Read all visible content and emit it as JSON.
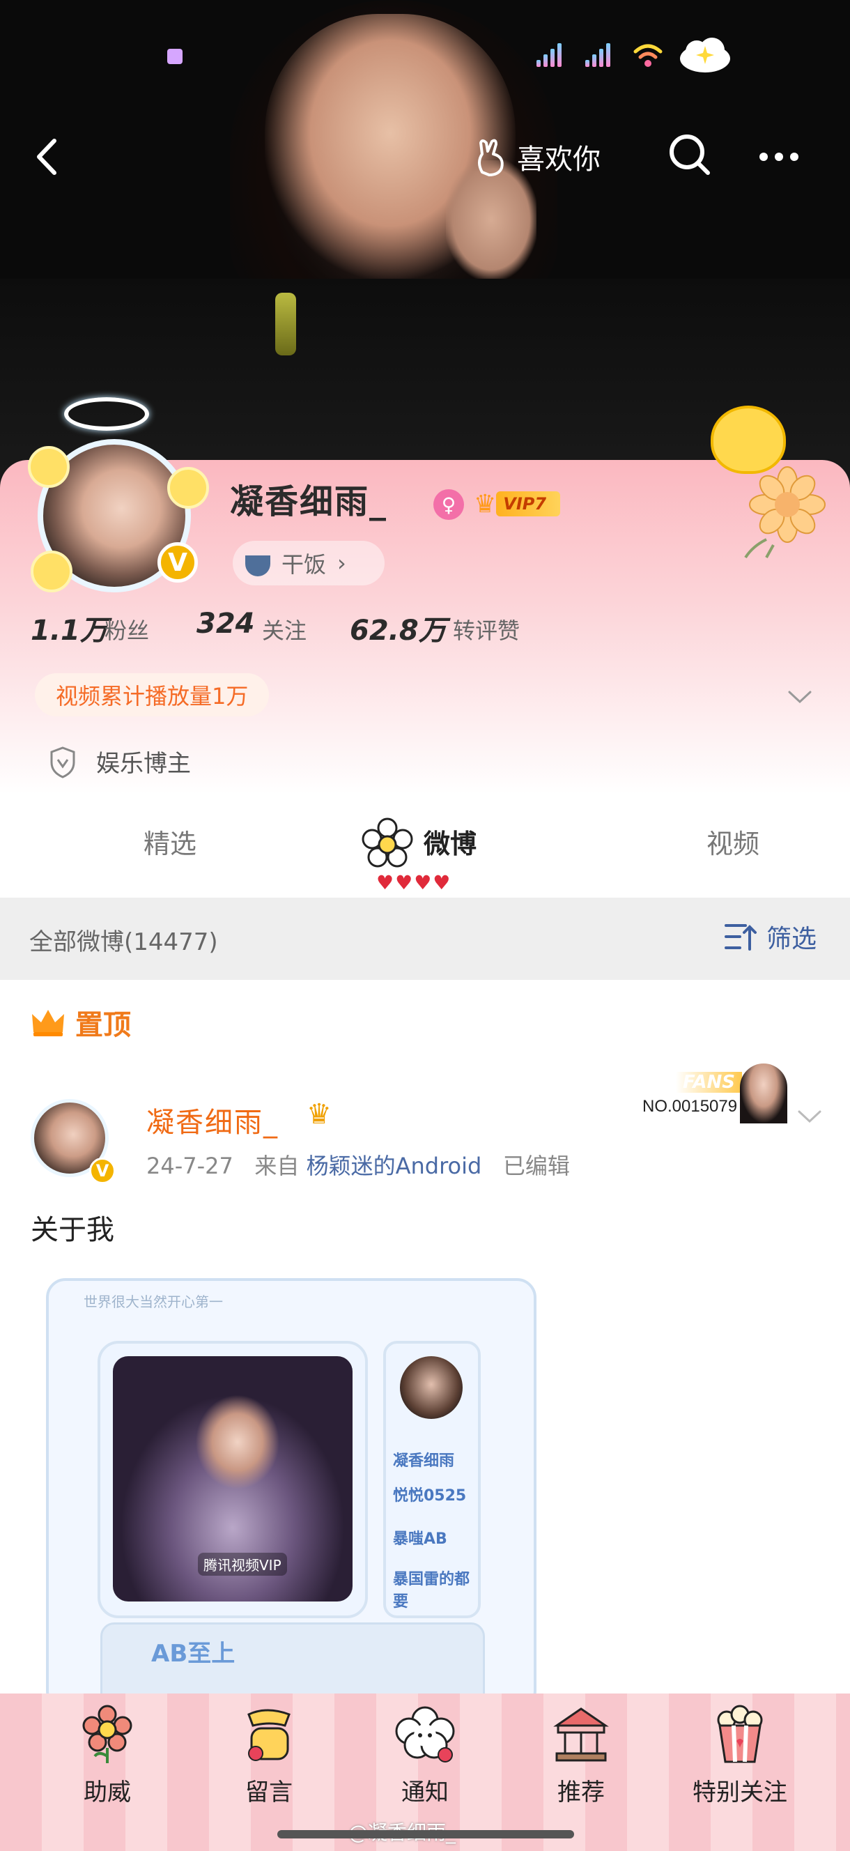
{
  "header": {
    "like_you_label": "喜欢你"
  },
  "profile": {
    "username": "凝香细雨_",
    "vip_label": "VIP7",
    "status_label": "干饭",
    "verified_mark": "V",
    "gender_symbol": "♀",
    "stats": [
      {
        "value": "1.1万",
        "label": "粉丝"
      },
      {
        "value": "324",
        "label": "关注"
      },
      {
        "value": "62.8万",
        "label": "转评赞"
      }
    ],
    "video_plays": "视频累计播放量1万",
    "category": "娱乐博主"
  },
  "tabs": [
    {
      "label": "精选"
    },
    {
      "label": "微博"
    },
    {
      "label": "视频"
    }
  ],
  "tab_hearts": "♥♥♥♥",
  "filter": {
    "all_posts": "全部微博(14477)",
    "filter_label": "筛选"
  },
  "pinned": {
    "label": "置顶",
    "author": "凝香细雨_",
    "date": "24-7-27",
    "from_prefix": "来自",
    "source": "杨颖迷的Android",
    "edited": "已编辑",
    "fans_label": "FANS",
    "fans_number": "NO.0015079",
    "text": "关于我",
    "image": {
      "top_text": "世界很大当然开心第一",
      "video_tag": "腾讯视频VIP",
      "side_lines": [
        "凝香细雨",
        "悦悦0525",
        "暴嗤AB",
        "暴国雷的都要"
      ],
      "card_title": "AB至上"
    }
  },
  "bottom_bar": [
    {
      "label": "助威",
      "icon": "flower-icon"
    },
    {
      "label": "留言",
      "icon": "phone-icon"
    },
    {
      "label": "通知",
      "icon": "cloud-icon"
    },
    {
      "label": "推荐",
      "icon": "carousel-icon"
    },
    {
      "label": "特别关注",
      "icon": "popcorn-icon"
    }
  ],
  "watermark": "@凝香细雨_",
  "colors": {
    "accent_orange": "#f06a14",
    "pink_card": "#fbb8c0",
    "link_blue": "#3d5fa0"
  }
}
